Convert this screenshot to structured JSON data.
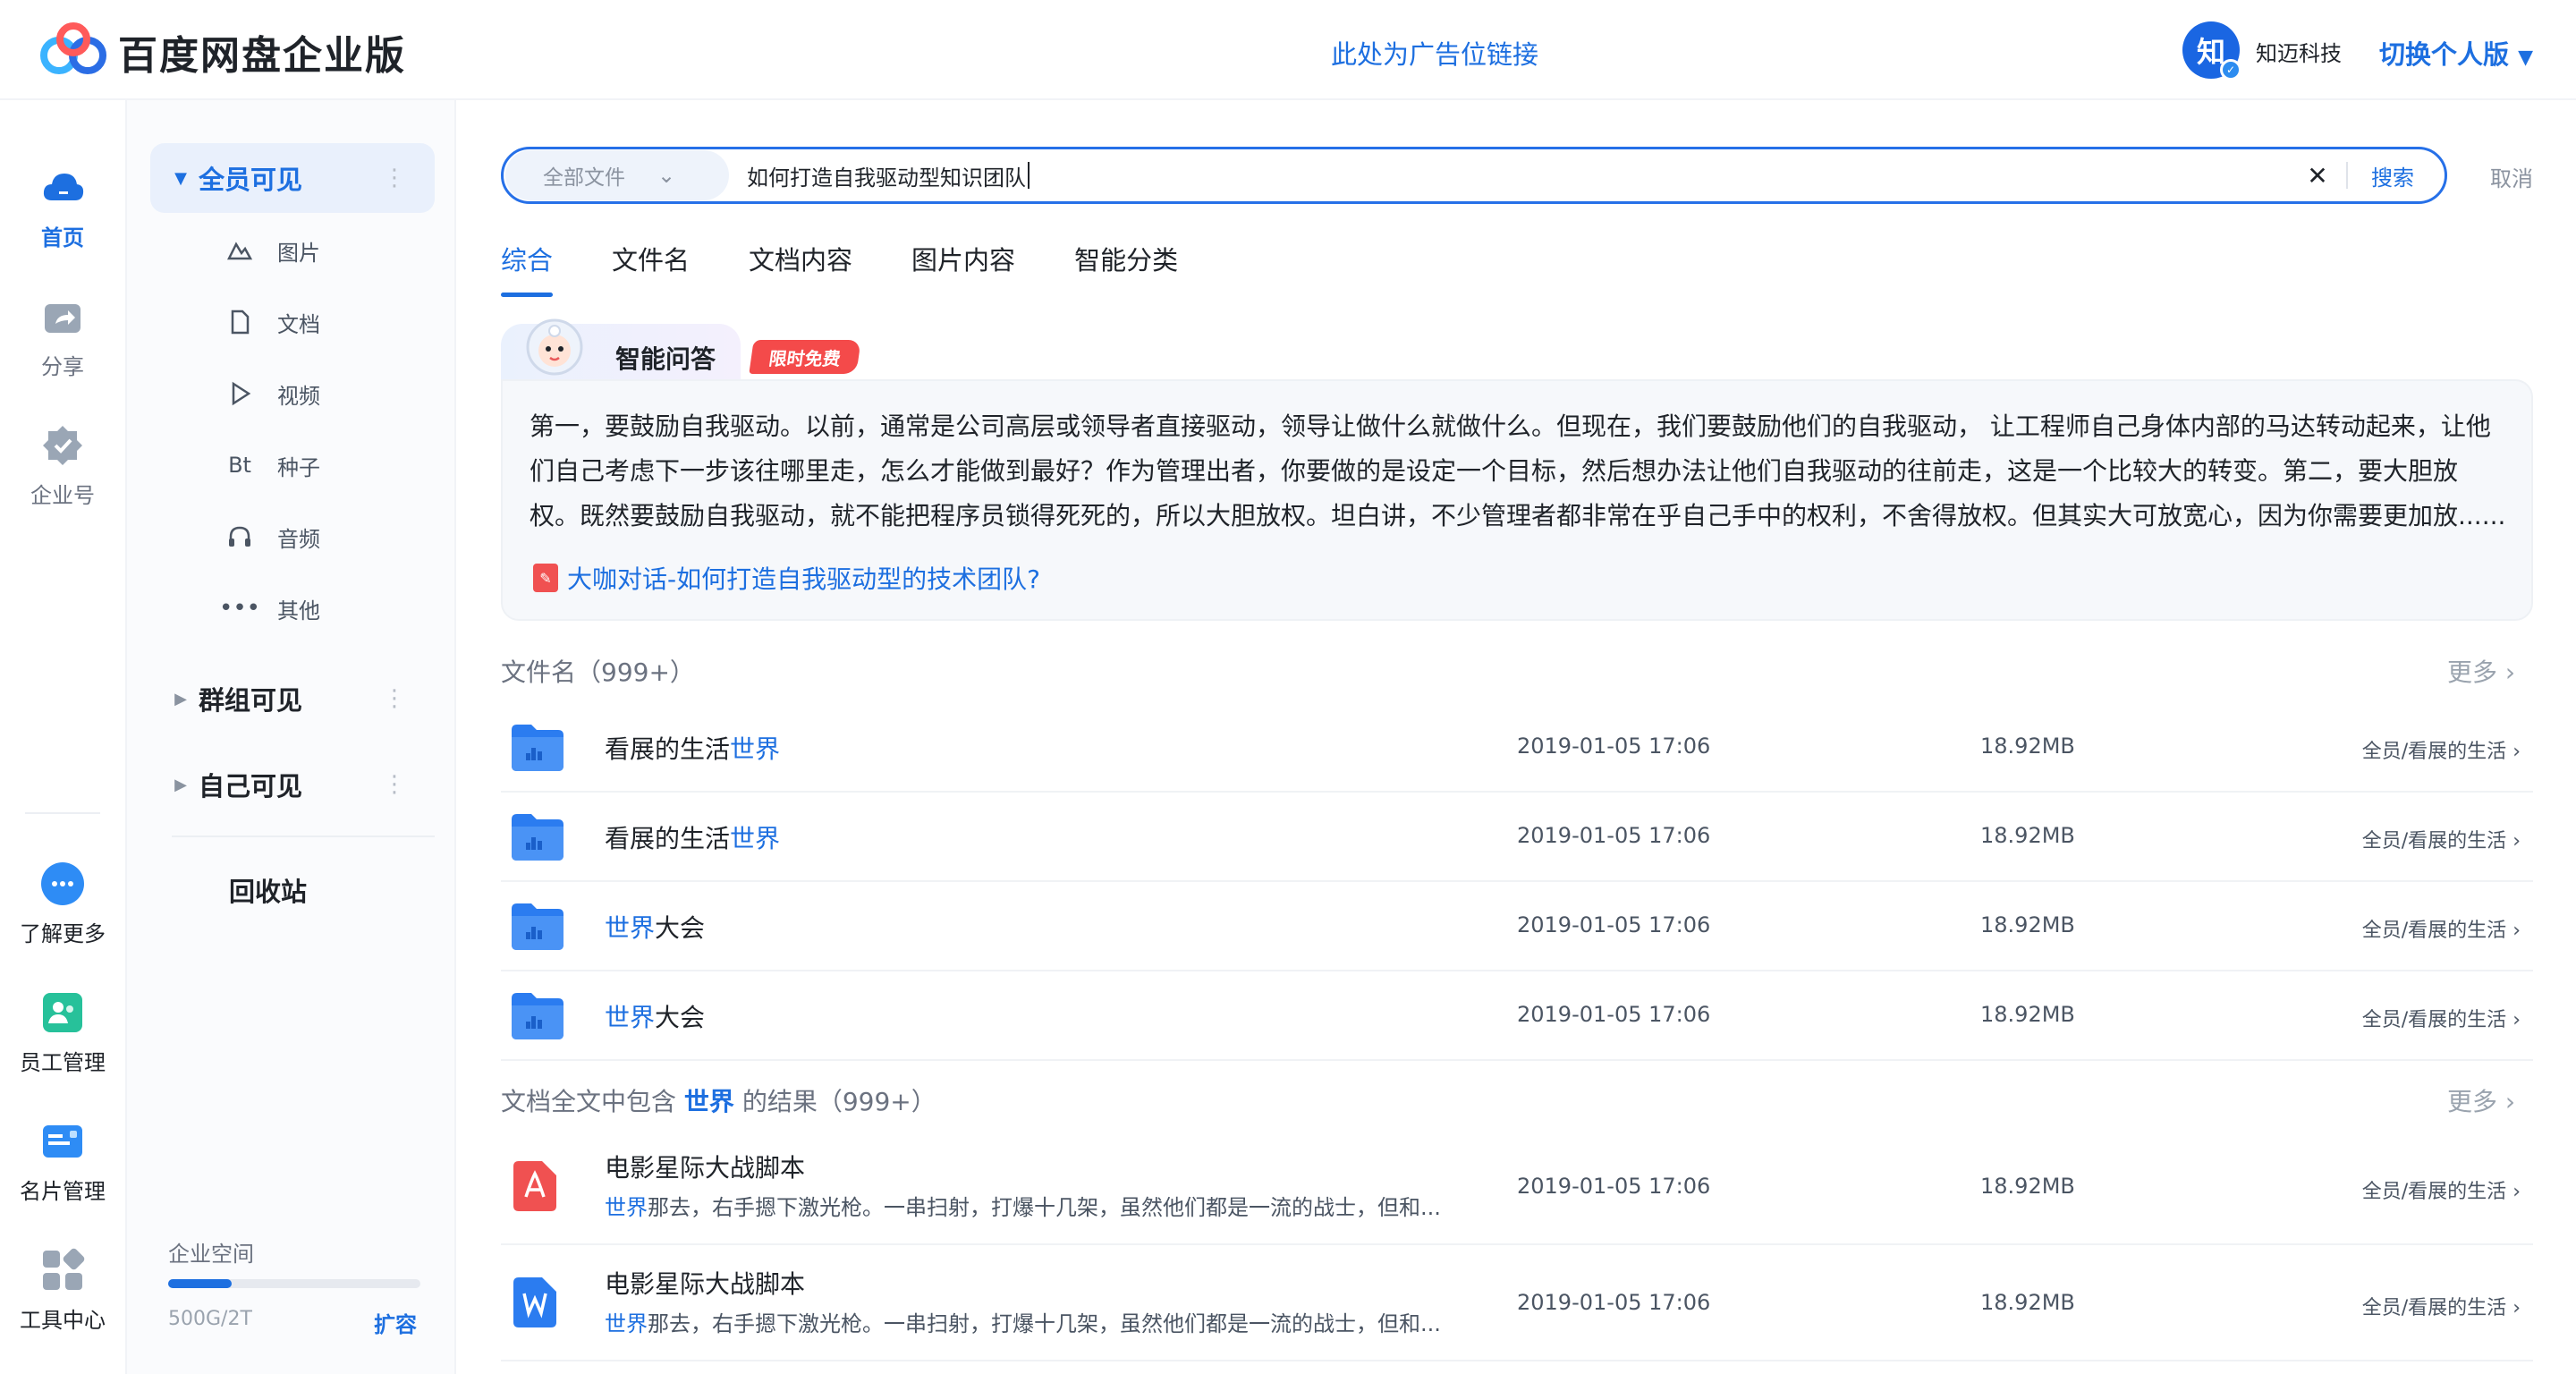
{
  "header": {
    "logo_text": "百度网盘企业版",
    "ad_link": "此处为广告位链接",
    "avatar_char": "知",
    "company": "知迈科技",
    "switch_label": "切换个人版"
  },
  "rail": [
    {
      "label": "首页",
      "icon": "cloud-home-icon",
      "active": true
    },
    {
      "label": "分享",
      "icon": "share-icon",
      "active": false
    },
    {
      "label": "企业号",
      "icon": "enterprise-badge-icon",
      "active": false
    },
    {
      "label": "了解更多",
      "icon": "more-chat-icon",
      "active": false
    },
    {
      "label": "员工管理",
      "icon": "staff-icon",
      "active": false
    },
    {
      "label": "名片管理",
      "icon": "card-icon",
      "active": false
    },
    {
      "label": "工具中心",
      "icon": "tools-grid-icon",
      "active": false
    }
  ],
  "sidebar": {
    "groups": [
      "全员可见",
      "群组可见",
      "自己可见"
    ],
    "sub_items": [
      {
        "label": "图片",
        "icon": "image-icon"
      },
      {
        "label": "文档",
        "icon": "document-icon"
      },
      {
        "label": "视频",
        "icon": "video-play-icon"
      },
      {
        "label": "种子",
        "icon": "bt-icon",
        "glyph": "Bt"
      },
      {
        "label": "音频",
        "icon": "headphones-icon"
      },
      {
        "label": "其他",
        "icon": "more-dots-icon"
      }
    ],
    "recycle": "回收站",
    "quota": {
      "title": "企业空间",
      "text": "500G/2T",
      "expand": "扩容",
      "used_fraction": 0.25
    }
  },
  "search": {
    "scope": "全部文件",
    "query": "如何打造自我驱动型知识团队",
    "search_btn": "搜索",
    "cancel": "取消"
  },
  "tabs": [
    "综合",
    "文件名",
    "文档内容",
    "图片内容",
    "智能分类"
  ],
  "ai": {
    "title": "智能问答",
    "badge": "限时免费",
    "answer": "第一，要鼓励自我驱动。以前，通常是公司高层或领导者直接驱动，领导让做什么就做什么。但现在，我们要鼓励他们的自我驱动， 让工程师自己身体内部的马达转动起来，让他们自己考虑下一步该往哪里走，怎么才能做到最好？作为管理出者，你要做的是设定一个目标，然后想办法让他们自我驱动的往前走，这是一个比较大的转变。第二，要大胆放权。既然要鼓励自我驱动，就不能把程序员锁得死死的，所以大胆放权。坦白讲，不少管理者都非常在乎自己手中的权利，不舍得放权。但其实大可放宽心，因为你需要更加放......",
    "source": "大咖对话-如何打造自我驱动型的技术团队?"
  },
  "filename_section": {
    "title": "文件名（999+）",
    "more": "更多",
    "rows": [
      {
        "name_pre": "看展的生活",
        "name_hl": "世界",
        "name_post": "",
        "date": "2019-01-05 17:06",
        "size": "18.92MB",
        "path": "全员/看展的生活"
      },
      {
        "name_pre": "看展的生活",
        "name_hl": "世界",
        "name_post": "",
        "date": "2019-01-05 17:06",
        "size": "18.92MB",
        "path": "全员/看展的生活"
      },
      {
        "name_pre": "",
        "name_hl": "世界",
        "name_post": "大会",
        "date": "2019-01-05 17:06",
        "size": "18.92MB",
        "path": "全员/看展的生活"
      },
      {
        "name_pre": "",
        "name_hl": "世界",
        "name_post": "大会",
        "date": "2019-01-05 17:06",
        "size": "18.92MB",
        "path": "全员/看展的生活"
      }
    ]
  },
  "fulltext_section": {
    "title_pre": "文档全文中包含",
    "title_hl": "世界",
    "title_post": "的结果（999+）",
    "more": "更多",
    "rows": [
      {
        "type": "pdf",
        "name": "电影星际大战脚本",
        "snip_hl": "世界",
        "snip": "那去，右手摁下激光枪。一串扫射，打爆十几架，虽然他们都是一流的战士，但和...",
        "date": "2019-01-05 17:06",
        "size": "18.92MB",
        "path": "全员/看展的生活"
      },
      {
        "type": "word",
        "name": "电影星际大战脚本",
        "snip_hl": "世界",
        "snip": "那去，右手摁下激光枪。一串扫射，打爆十几架，虽然他们都是一流的战士，但和...",
        "date": "2019-01-05 17:06",
        "size": "18.92MB",
        "path": "全员/看展的生活"
      }
    ]
  },
  "colors": {
    "accent": "#1d6fe0",
    "badge": "#f44a4a",
    "folder": "#2b7cf0"
  }
}
